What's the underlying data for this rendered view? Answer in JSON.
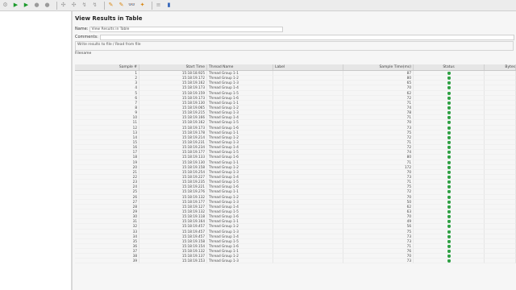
{
  "toolbar": {
    "buttons": [
      {
        "icon": "gear-icon",
        "glyph": "⚙",
        "color": "gray"
      },
      {
        "icon": "play-icon",
        "glyph": "▶",
        "color": "play"
      },
      {
        "icon": "play-no-pause-icon",
        "glyph": "▶",
        "color": "play"
      },
      {
        "icon": "stop-icon",
        "glyph": "●",
        "color": "gray"
      },
      {
        "icon": "shutdown-icon",
        "glyph": "●",
        "color": "gray"
      },
      {
        "icon": "remote-start-icon",
        "glyph": "✣",
        "color": "gray"
      },
      {
        "icon": "remote-start-all-icon",
        "glyph": "✣",
        "color": "gray"
      },
      {
        "icon": "remote-stop-icon",
        "glyph": "↯",
        "color": "gray"
      },
      {
        "icon": "remote-stop-all-icon",
        "glyph": "↯",
        "color": "gray"
      },
      {
        "icon": "clear-icon",
        "glyph": "✎",
        "color": "orange"
      },
      {
        "icon": "clear-all-icon",
        "glyph": "✎",
        "color": "orange"
      },
      {
        "icon": "search-icon",
        "glyph": "👓",
        "color": "gray"
      },
      {
        "icon": "reset-search-icon",
        "glyph": "✦",
        "color": "orange"
      },
      {
        "icon": "function-helper-icon",
        "glyph": "≡",
        "color": "gray"
      },
      {
        "icon": "help-icon",
        "glyph": "▮",
        "color": "blue"
      }
    ]
  },
  "panel": {
    "title": "View Results in Table",
    "name_label": "Name:",
    "name_value": "View Results in Table",
    "comments_label": "Comments:",
    "write_label": "Write results to file / Read from file",
    "filename_label": "Filename"
  },
  "table": {
    "headers": [
      "Sample #",
      "Start Time",
      "Thread Name",
      "Label",
      "Sample Time(ms)",
      "Status",
      "Bytes"
    ],
    "rows": [
      [
        "1",
        "15:18:18.925",
        "Thread Group 1-1",
        "",
        "87",
        "ok"
      ],
      [
        "2",
        "15:18:19.172",
        "Thread Group 1-2",
        "",
        "80",
        "ok"
      ],
      [
        "3",
        "15:18:19.162",
        "Thread Group 1-3",
        "",
        "65",
        "ok"
      ],
      [
        "4",
        "15:18:19.173",
        "Thread Group 1-4",
        "",
        "70",
        "ok"
      ],
      [
        "5",
        "15:18:19.159",
        "Thread Group 1-5",
        "",
        "62",
        "ok"
      ],
      [
        "6",
        "15:18:19.173",
        "Thread Group 1-6",
        "",
        "72",
        "ok"
      ],
      [
        "7",
        "15:18:19.130",
        "Thread Group 1-1",
        "",
        "71",
        "ok"
      ],
      [
        "8",
        "15:18:19.065",
        "Thread Group 1-2",
        "",
        "74",
        "ok"
      ],
      [
        "9",
        "15:18:19.215",
        "Thread Group 1-3",
        "",
        "78",
        "ok"
      ],
      [
        "10",
        "15:18:19.166",
        "Thread Group 1-4",
        "",
        "71",
        "ok"
      ],
      [
        "11",
        "15:18:19.162",
        "Thread Group 1-5",
        "",
        "70",
        "ok"
      ],
      [
        "12",
        "15:18:19.173",
        "Thread Group 1-6",
        "",
        "73",
        "ok"
      ],
      [
        "13",
        "15:18:19.178",
        "Thread Group 1-1",
        "",
        "75",
        "ok"
      ],
      [
        "14",
        "15:18:19.214",
        "Thread Group 1-2",
        "",
        "72",
        "ok"
      ],
      [
        "15",
        "15:18:19.231",
        "Thread Group 1-3",
        "",
        "71",
        "ok"
      ],
      [
        "16",
        "15:18:19.234",
        "Thread Group 1-4",
        "",
        "72",
        "ok"
      ],
      [
        "17",
        "15:18:19.177",
        "Thread Group 1-5",
        "",
        "74",
        "ok"
      ],
      [
        "18",
        "15:18:19.133",
        "Thread Group 1-6",
        "",
        "80",
        "ok"
      ],
      [
        "19",
        "15:18:19.130",
        "Thread Group 1-1",
        "",
        "71",
        "ok"
      ],
      [
        "20",
        "15:18:19.158",
        "Thread Group 1-2",
        "",
        "172",
        "ok"
      ],
      [
        "21",
        "15:18:19.254",
        "Thread Group 1-3",
        "",
        "70",
        "ok"
      ],
      [
        "22",
        "15:18:19.227",
        "Thread Group 1-4",
        "",
        "73",
        "ok"
      ],
      [
        "23",
        "15:18:19.235",
        "Thread Group 1-5",
        "",
        "71",
        "ok"
      ],
      [
        "24",
        "15:18:19.221",
        "Thread Group 1-6",
        "",
        "75",
        "ok"
      ],
      [
        "25",
        "15:18:19.276",
        "Thread Group 1-1",
        "",
        "72",
        "ok"
      ],
      [
        "26",
        "15:18:19.132",
        "Thread Group 1-2",
        "",
        "70",
        "ok"
      ],
      [
        "27",
        "15:18:19.177",
        "Thread Group 1-3",
        "",
        "50",
        "ok"
      ],
      [
        "28",
        "15:18:19.127",
        "Thread Group 1-4",
        "",
        "62",
        "ok"
      ],
      [
        "29",
        "15:18:19.132",
        "Thread Group 1-5",
        "",
        "63",
        "ok"
      ],
      [
        "30",
        "15:18:19.118",
        "Thread Group 1-6",
        "",
        "70",
        "ok"
      ],
      [
        "31",
        "15:18:19.164",
        "Thread Group 1-1",
        "",
        "49",
        "ok"
      ],
      [
        "32",
        "15:18:19.457",
        "Thread Group 1-2",
        "",
        "56",
        "ok"
      ],
      [
        "33",
        "15:18:19.457",
        "Thread Group 1-3",
        "",
        "75",
        "ok"
      ],
      [
        "34",
        "15:18:19.457",
        "Thread Group 1-4",
        "",
        "73",
        "ok"
      ],
      [
        "35",
        "15:18:19.158",
        "Thread Group 1-5",
        "",
        "73",
        "ok"
      ],
      [
        "36",
        "15:18:19.154",
        "Thread Group 1-6",
        "",
        "71",
        "ok"
      ],
      [
        "37",
        "15:18:19.132",
        "Thread Group 1-1",
        "",
        "76",
        "ok"
      ],
      [
        "38",
        "15:18:19.137",
        "Thread Group 1-2",
        "",
        "70",
        "ok"
      ],
      [
        "39",
        "15:18:19.153",
        "Thread Group 1-3",
        "",
        "73",
        "ok"
      ]
    ]
  },
  "colors": {
    "status_ok": "#2ea043",
    "panel_bg": "#f6f6f6",
    "toolbar_bg": "#ececec"
  }
}
